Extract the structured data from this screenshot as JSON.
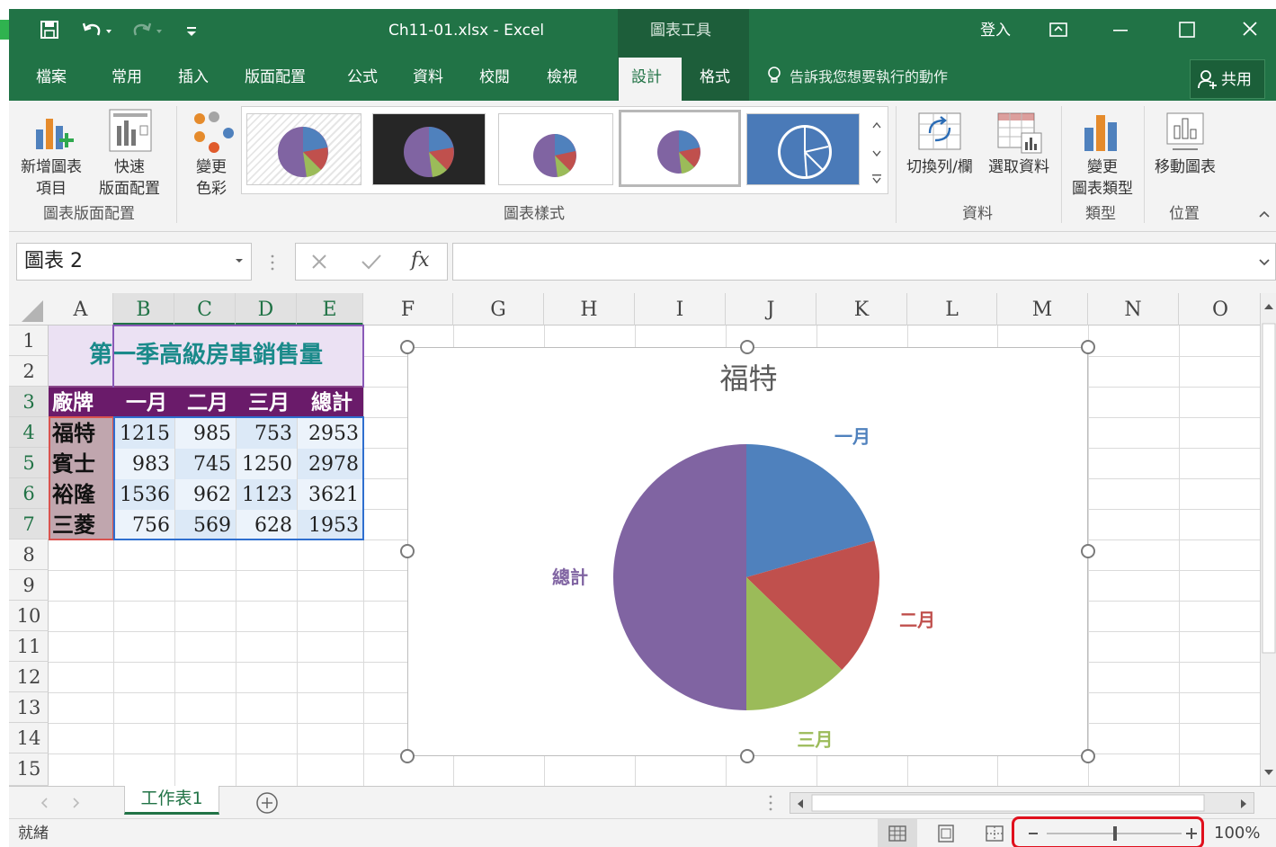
{
  "window": {
    "title": "Ch11-01.xlsx - Excel",
    "context_tool": "圖表工具",
    "signin": "登入"
  },
  "tabs": [
    "檔案",
    "常用",
    "插入",
    "版面配置",
    "公式",
    "資料",
    "校閱",
    "檢視",
    "設計",
    "格式"
  ],
  "active_tab": "設計",
  "tell_me": "告訴我您想要執行的動作",
  "share": "共用",
  "ribbon": {
    "add_element": [
      "新增圖表",
      "項目"
    ],
    "quick_layout": [
      "快速",
      "版面配置"
    ],
    "change_color": [
      "變更",
      "色彩"
    ],
    "switch_row_col": "切換列/欄",
    "select_data": "選取資料",
    "change_type": [
      "變更",
      "圖表類型"
    ],
    "move_chart": "移動圖表",
    "groups": {
      "layouts": "圖表版面配置",
      "styles": "圖表樣式",
      "data": "資料",
      "type": "類型",
      "location": "位置"
    }
  },
  "name_box": "圖表 2",
  "formula_value": "",
  "columns": [
    "A",
    "B",
    "C",
    "D",
    "E",
    "F",
    "G",
    "H",
    "I",
    "J",
    "K",
    "L",
    "M",
    "N",
    "O"
  ],
  "rows": [
    "1",
    "2",
    "3",
    "4",
    "5",
    "6",
    "7",
    "8",
    "9",
    "10",
    "11",
    "12",
    "13",
    "14",
    "15"
  ],
  "sheet": {
    "title": "第一季高級房車銷售量",
    "headers": [
      "廠牌",
      "一月",
      "二月",
      "三月",
      "總計"
    ],
    "data": [
      [
        "福特",
        "1215",
        "985",
        "753",
        "2953"
      ],
      [
        "賓士",
        "983",
        "745",
        "1250",
        "2978"
      ],
      [
        "裕隆",
        "1536",
        "962",
        "1123",
        "3621"
      ],
      [
        "三菱",
        "756",
        "569",
        "628",
        "1953"
      ]
    ]
  },
  "chart_data": {
    "type": "pie",
    "title": "福特",
    "labels": [
      "一月",
      "二月",
      "三月",
      "總計"
    ],
    "values": [
      1215,
      985,
      753,
      2953
    ],
    "colors": [
      "#4f81bd",
      "#c0504d",
      "#9bbb59",
      "#8064a2"
    ]
  },
  "sheet_tab": "工作表1",
  "status": {
    "ready": "就緒",
    "zoom": "100%"
  }
}
